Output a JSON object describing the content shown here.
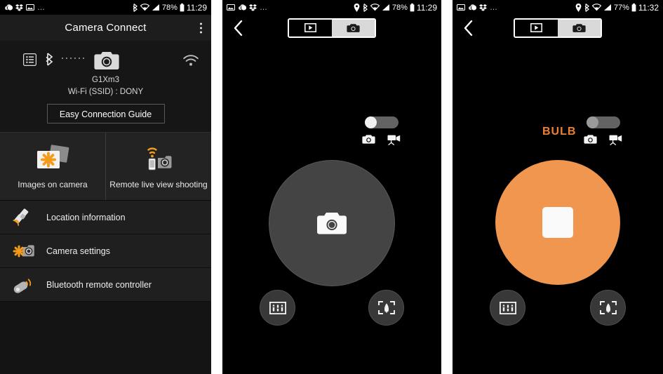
{
  "panels": {
    "home": {
      "status": {
        "left_icons": [
          "weather-icon",
          "dropbox-icon",
          "gallery-icon"
        ],
        "overflow": "…",
        "bluetooth": "bluetooth-icon",
        "wifi": "wifi-icon",
        "signal": "signal-icon",
        "battery_percent": "78%",
        "battery": "battery-icon",
        "time": "11:29"
      },
      "title": "Camera Connect",
      "overflow_menu": "overflow-menu-icon",
      "connection": {
        "list_icon": "list-icon",
        "bluetooth_icon": "bluetooth-icon",
        "camera_icon": "camera-icon",
        "wifi_icon": "wifi-icon",
        "camera_name": "G1Xm3",
        "ssid_line": "Wi-Fi (SSID) :  DONY",
        "guide_button": "Easy Connection Guide"
      },
      "tiles": [
        {
          "label": "Images on camera",
          "icon": "photos-stack-icon"
        },
        {
          "label": "Remote live view shooting",
          "icon": "remote-camera-icon"
        }
      ],
      "rows": [
        {
          "label": "Location information",
          "icon": "satellite-icon"
        },
        {
          "label": "Camera settings",
          "icon": "camera-gear-icon"
        },
        {
          "label": "Bluetooth remote controller",
          "icon": "bluetooth-remote-icon"
        }
      ]
    },
    "liveview_idle": {
      "status": {
        "left_icons": [
          "gallery-icon",
          "weather-icon",
          "dropbox-icon"
        ],
        "overflow": "…",
        "location": "location-pin-icon",
        "bluetooth": "bluetooth-icon",
        "wifi": "wifi-icon",
        "signal": "signal-icon",
        "battery_percent": "78%",
        "battery": "battery-icon",
        "time": "11:29"
      },
      "back": "back-chevron-icon",
      "segments": [
        {
          "icon": "video-playback-icon",
          "selected": false
        },
        {
          "icon": "camera-icon",
          "selected": true
        }
      ],
      "mode_toggle": {
        "knob": "left",
        "left_icon": "camera-icon",
        "right_icon": "movie-camera-icon"
      },
      "shutter": {
        "icon": "camera-icon",
        "state": "idle"
      },
      "buttons": [
        {
          "icon": "exposure-bars-icon",
          "position": "left"
        },
        {
          "icon": "focus-landscape-icon",
          "position": "right"
        }
      ]
    },
    "liveview_bulb": {
      "status": {
        "left_icons": [
          "gallery-icon",
          "weather-icon",
          "dropbox-icon"
        ],
        "overflow": "…",
        "location": "location-pin-icon",
        "bluetooth": "bluetooth-icon",
        "wifi": "wifi-icon",
        "signal": "signal-icon",
        "battery_percent": "77%",
        "battery": "battery-icon",
        "time": "11:32"
      },
      "back": "back-chevron-icon",
      "segments": [
        {
          "icon": "video-playback-icon",
          "selected": false
        },
        {
          "icon": "camera-icon",
          "selected": true
        }
      ],
      "bulb_label": "BULB",
      "mode_toggle": {
        "knob": "left",
        "left_icon": "camera-icon",
        "right_icon": "movie-camera-icon"
      },
      "shutter": {
        "icon": "stop-square-icon",
        "state": "recording"
      },
      "buttons": [
        {
          "icon": "exposure-bars-icon",
          "position": "left"
        },
        {
          "icon": "focus-landscape-icon",
          "position": "right"
        }
      ]
    }
  },
  "colors": {
    "accent_orange": "#f1964f",
    "bulb_orange": "#ef8033",
    "panel_bg": "#1d1d1d",
    "shutter_idle": "#444444",
    "page_bg": "#000000"
  }
}
